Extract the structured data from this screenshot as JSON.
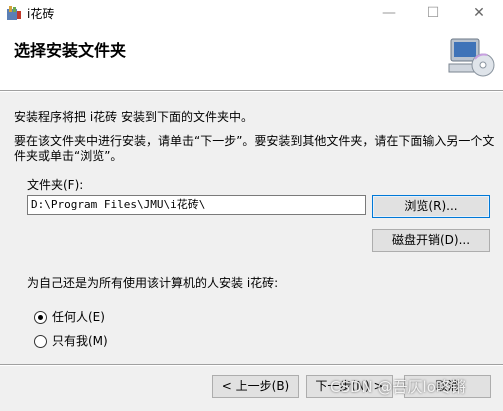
{
  "window": {
    "title": "i花砖",
    "minimize_glyph": "—",
    "maximize_glyph": "☐",
    "close_glyph": "✕"
  },
  "header": {
    "title": "选择安装文件夹"
  },
  "body": {
    "line1": "安装程序将把 i花砖 安装到下面的文件夹中。",
    "line2": "要在该文件夹中进行安装，请单击“下一步”。要安装到其他文件夹，请在下面输入另一个文件夹或单击“浏览”。"
  },
  "folder": {
    "label": "文件夹(F):",
    "value": "D:\\Program Files\\JMU\\i花砖\\",
    "browse_label": "浏览(R)...",
    "disk_cost_label": "磁盘开销(D)..."
  },
  "install_for": {
    "question": "为自己还是为所有使用该计算机的人安装 i花砖:",
    "options": [
      {
        "label": "任何人(E)",
        "selected": true
      },
      {
        "label": "只有我(M)",
        "selected": false
      }
    ]
  },
  "footer": {
    "back_label": "< 上一步(B)",
    "next_label": "下一步(N) >",
    "cancel_label": "取消"
  },
  "watermark": "CSDN @吾仄lo咚锵",
  "colors": {
    "focus_border": "#0078d7",
    "radio_accent": "#0078d7"
  },
  "icons": {
    "app": "installer-app-icon",
    "header_art": "computer-cd-icon"
  }
}
